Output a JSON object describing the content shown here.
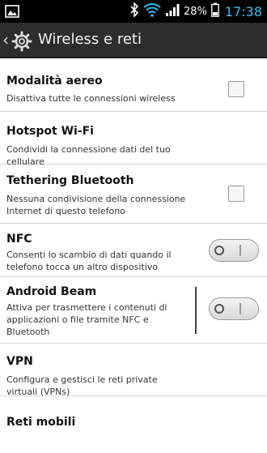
{
  "status_bar": {
    "battery_percent": "28%",
    "time": "17:38",
    "icons": [
      "image-icon",
      "bluetooth-icon",
      "wifi-icon",
      "signal-icon",
      "battery-icon"
    ]
  },
  "action_bar": {
    "title": "Wireless e reti",
    "icons": [
      "back-icon",
      "settings-gear-icon"
    ]
  },
  "items": [
    {
      "title": "Modalità aereo",
      "subtitle": "Disattiva tutte le connessioni wireless",
      "control": "checkbox",
      "checked": false
    },
    {
      "title": "Hotspot Wi-Fi",
      "subtitle": "Condividi la connessione dati del tuo cellulare",
      "control": "none"
    },
    {
      "title": "Tethering Bluetooth",
      "subtitle": "Nessuna condivisione della connessione Internet di questo telefono",
      "control": "checkbox",
      "checked": false
    },
    {
      "title": "NFC",
      "subtitle": "Consenti lo scambio di dati quando il telefono tocca un altro dispositivo",
      "control": "toggle",
      "on": false
    },
    {
      "title": "Android Beam",
      "subtitle": "Attiva per trasmettere i contenuti di applicazioni o file tramite NFC e Bluetooth",
      "control": "toggle",
      "on": false
    },
    {
      "title": "VPN",
      "subtitle": "Configura e gestisci le reti private virtuali (VPNs)",
      "control": "none"
    },
    {
      "title": "Reti mobili",
      "subtitle": "",
      "control": "none"
    }
  ],
  "colors": {
    "status_bar_bg": "#000000",
    "clock": "#2fc3f2",
    "action_bar_bg": "#2d2d2d",
    "list_bg": "#ffffff",
    "divider": "#d6d6d6"
  }
}
